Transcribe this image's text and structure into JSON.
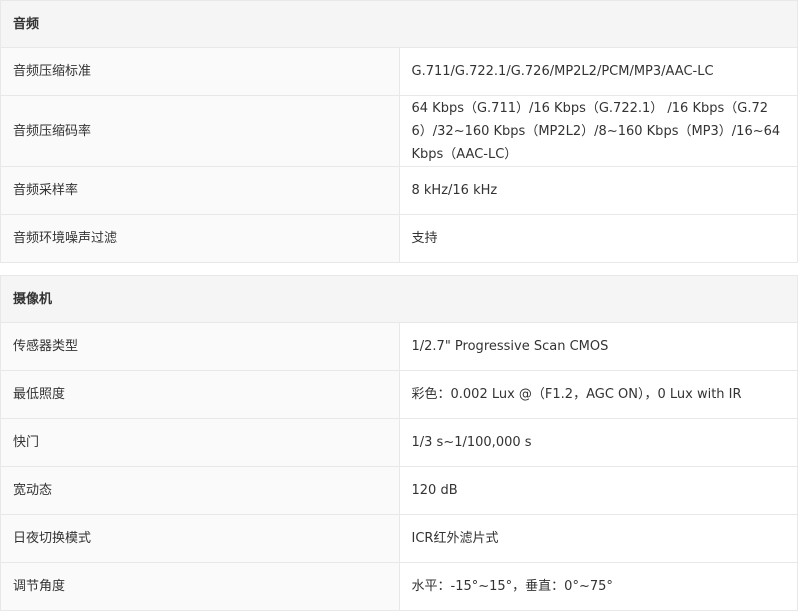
{
  "sections": [
    {
      "title": "音频",
      "rows": [
        {
          "label": "音频压缩标准",
          "value": "G.711/G.722.1/G.726/MP2L2/PCM/MP3/AAC-LC"
        },
        {
          "label": "音频压缩码率",
          "value": "64 Kbps（G.711）/16 Kbps（G.722.1） /16 Kbps（G.726）/32~160 Kbps（MP2L2）/8~160 Kbps（MP3）/16~64 Kbps（AAC-LC）"
        },
        {
          "label": "音频采样率",
          "value": "8 kHz/16 kHz"
        },
        {
          "label": "音频环境噪声过滤",
          "value": "支持"
        }
      ]
    },
    {
      "title": "摄像机",
      "rows": [
        {
          "label": "传感器类型",
          "value": "1/2.7\" Progressive Scan CMOS"
        },
        {
          "label": "最低照度",
          "value": "彩色：0.002 Lux @（F1.2，AGC ON），0 Lux with IR"
        },
        {
          "label": "快门",
          "value": "1/3 s~1/100,000 s"
        },
        {
          "label": "宽动态",
          "value": "120 dB"
        },
        {
          "label": "日夜切换模式",
          "value": "ICR红外滤片式"
        },
        {
          "label": "调节角度",
          "value": "水平：-15°~15°，垂直：0°~75°"
        }
      ]
    }
  ]
}
